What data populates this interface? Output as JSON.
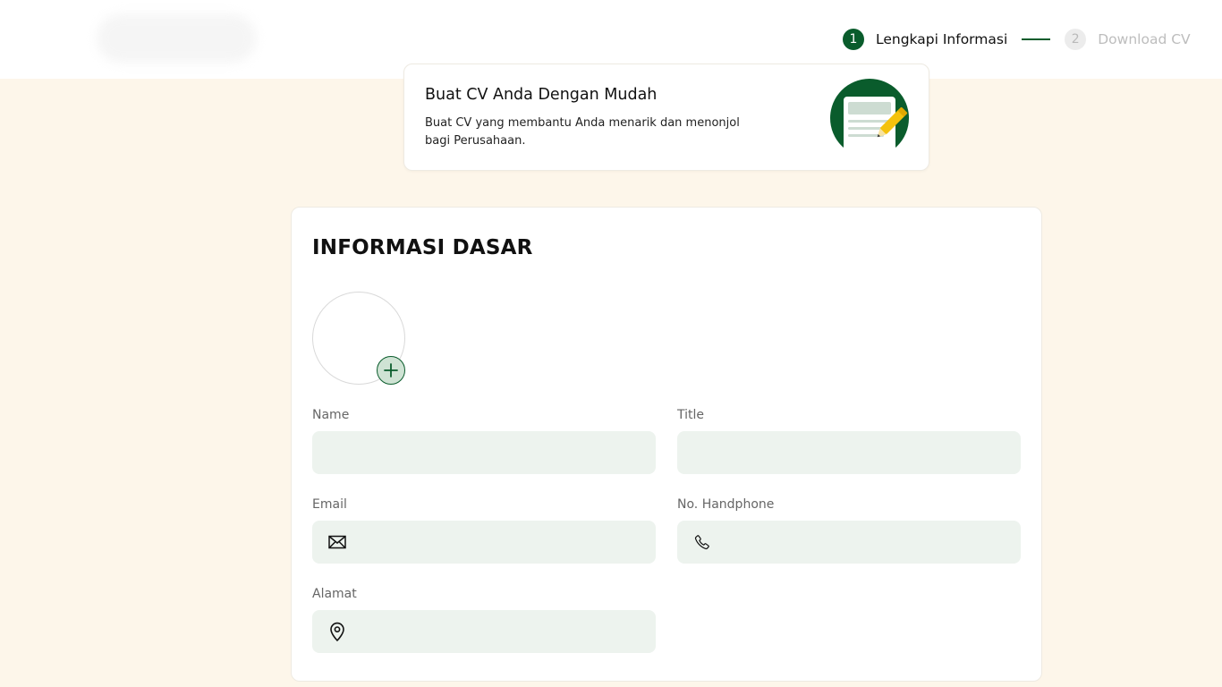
{
  "stepper": {
    "steps": [
      {
        "number": "1",
        "label": "Lengkapi Informasi"
      },
      {
        "number": "2",
        "label": "Download CV"
      }
    ]
  },
  "hero": {
    "title": "Buat CV Anda Dengan Mudah",
    "description": "Buat CV yang membantu Anda menarik dan menonjol bagi Perusahaan."
  },
  "form": {
    "title": "INFORMASI DASAR",
    "fields": {
      "name": {
        "label": "Name",
        "value": ""
      },
      "title": {
        "label": "Title",
        "value": ""
      },
      "email": {
        "label": "Email",
        "value": ""
      },
      "phone": {
        "label": "No. Handphone",
        "value": ""
      },
      "address": {
        "label": "Alamat",
        "value": ""
      }
    }
  },
  "icons": {
    "avatar_add": "plus-icon",
    "email": "envelope-icon",
    "phone": "phone-icon",
    "address": "map-pin-icon"
  },
  "colors": {
    "primary": "#0a5c2c",
    "page_background": "#fdf6ea",
    "input_background": "#edf3ee",
    "accent_yellow": "#f4c20d"
  }
}
